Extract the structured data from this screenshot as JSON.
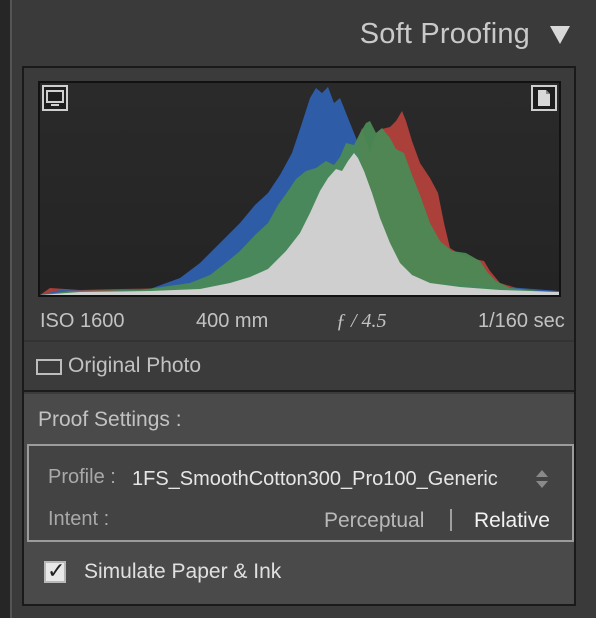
{
  "panel": {
    "title": "Soft Proofing",
    "collapse_icon": "triangle-down-icon"
  },
  "histogram": {
    "left_icon": "monitor-icon",
    "right_icon": "document-icon",
    "colors": {
      "blue": "#2f5fae",
      "green": "#4a8a55",
      "red": "#b2403a",
      "gray": "#c8c8c8"
    }
  },
  "exposure_info": {
    "iso": "ISO 1600",
    "focal_length": "400 mm",
    "aperture": "ƒ / 4.5",
    "shutter": "1/160 sec"
  },
  "original_photo": {
    "label": "Original Photo",
    "checked": false
  },
  "proof_settings": {
    "title": "Proof Settings :",
    "profile_label": "Profile :",
    "profile_value": "1FS_SmoothCotton300_Pro100_Generic",
    "intent_label": "Intent :",
    "intent_options": [
      "Perceptual",
      "Relative"
    ],
    "selected_intent": "Relative",
    "simulate_label": "Simulate Paper & Ink",
    "simulate_checked": true
  }
}
